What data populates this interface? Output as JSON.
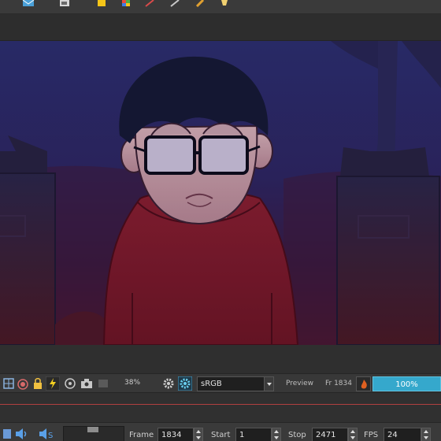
{
  "app": {
    "top_toolbar": {
      "icons": [
        "mail-icon",
        "image-icon",
        "note-icon",
        "color-palette-icon",
        "brush-icon",
        "pen-icon",
        "pencil-icon",
        "lamp-icon"
      ]
    }
  },
  "camera_toolbar": {
    "icons": [
      "grid-icon",
      "onion-skin-icon",
      "lock-icon",
      "lightning-icon",
      "turbo-icon",
      "camera-icon",
      "mask-icon"
    ],
    "zoom": "38%",
    "render_icons": [
      "gear-icon",
      "color-wheel-icon"
    ],
    "color_space": "sRGB",
    "preview_label": "Preview",
    "frame_indicator": "Fr 1834",
    "render_progress": "100%",
    "render_progress_value": 1.0,
    "accent": "#35a8cc"
  },
  "playback": {
    "icons": [
      "speaker-icon",
      "sound-scrub-icon"
    ],
    "frame_label": "Frame",
    "frame_value": "1834",
    "start_label": "Start",
    "start_value": "1",
    "stop_label": "Stop",
    "stop_value": "2471",
    "fps_label": "FPS",
    "fps_value": "24"
  }
}
